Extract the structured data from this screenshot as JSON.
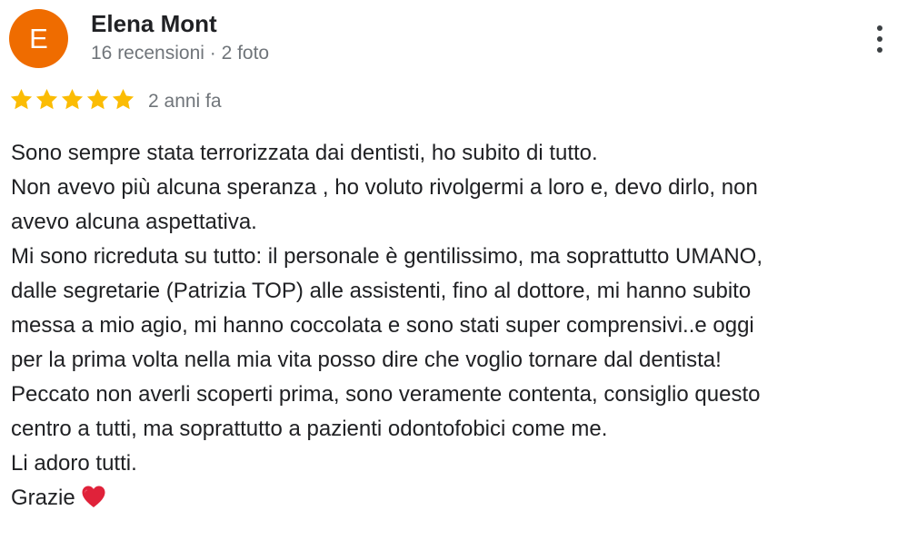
{
  "review": {
    "author": {
      "initial": "E",
      "name": "Elena Mont",
      "meta": "16 recensioni · 2 foto",
      "avatar_color": "#ef6c00"
    },
    "menu_icon": "more-vert-icon",
    "rating": 5,
    "star_color": "#fbbc04",
    "date": "2 anni fa",
    "text_lines": [
      "Sono sempre stata terrorizzata dai dentisti, ho subito di tutto.",
      "Non avevo più alcuna speranza , ho voluto rivolgermi a loro e, devo dirlo, non",
      "avevo alcuna aspettativa.",
      "Mi sono ricreduta su tutto: il personale è gentilissimo, ma soprattutto UMANO,",
      "dalle segretarie (Patrizia TOP) alle assistenti, fino al dottore, mi hanno subito",
      "messa a mio agio, mi hanno coccolata e sono stati super comprensivi..e oggi",
      "per la prima volta nella mia vita posso dire che voglio tornare dal dentista!",
      "Peccato non averli scoperti prima, sono veramente contenta, consiglio questo",
      "centro a tutti, ma soprattutto a pazienti odontofobici come me.",
      "Li adoro tutti.",
      "Grazie"
    ],
    "emoji": "red-heart-icon"
  }
}
